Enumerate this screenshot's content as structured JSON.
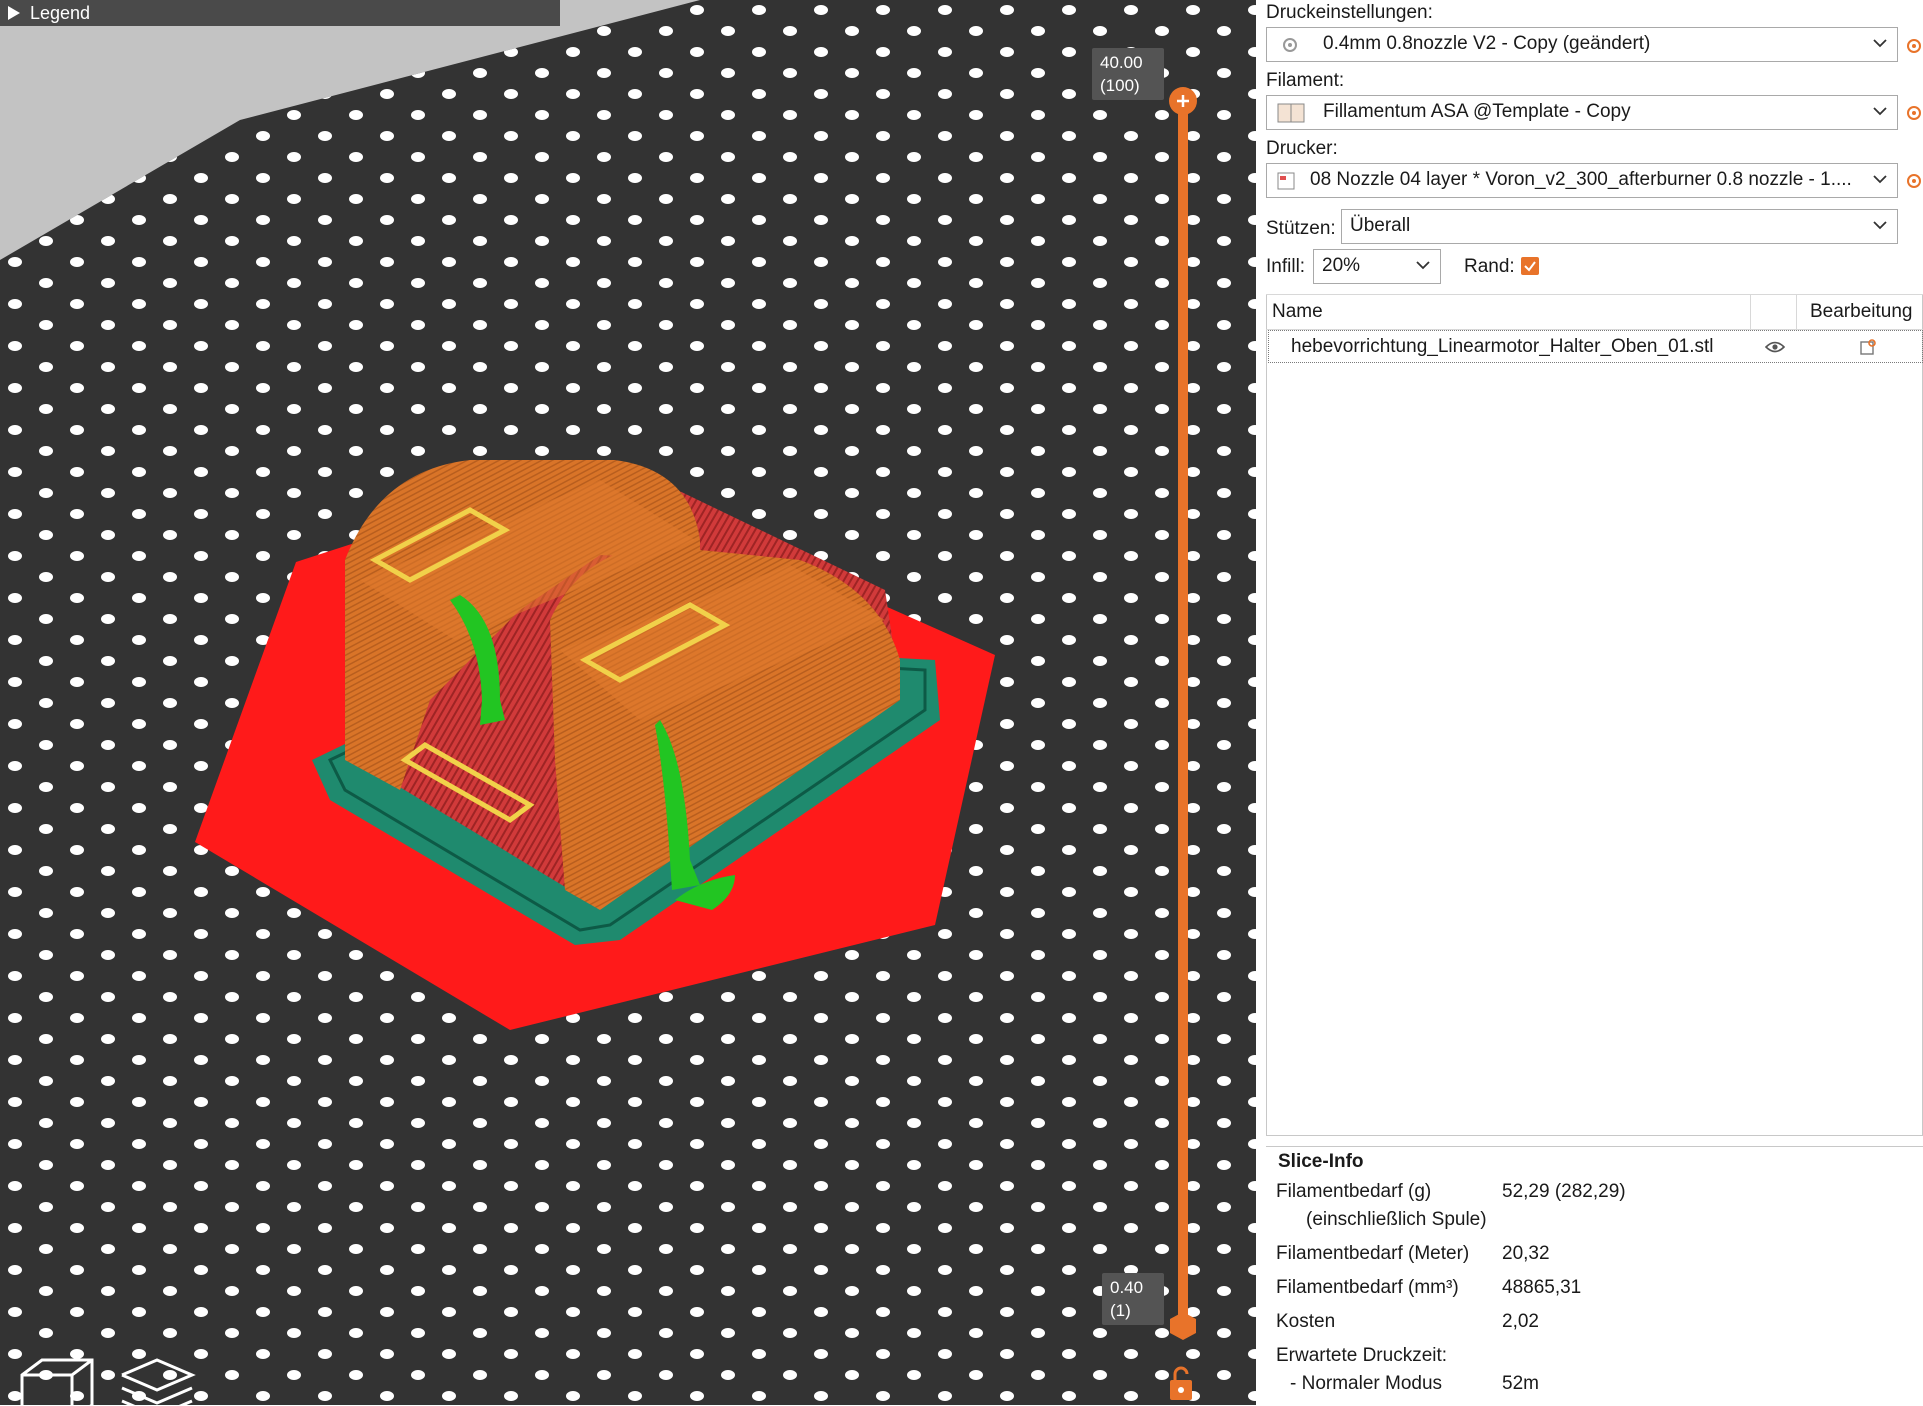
{
  "viewport": {
    "legend_label": "Legend",
    "slider": {
      "top_value": "40.00",
      "top_layer": "(100)",
      "bottom_value": "0.40",
      "bottom_layer": "(1)"
    },
    "accent_color": "#e8732a"
  },
  "print_settings": {
    "label": "Druckeinstellungen:",
    "value": "0.4mm 0.8nozzle V2 - Copy (geändert)"
  },
  "filament": {
    "label": "Filament:",
    "value": "Fillamentum ASA @Template - Copy"
  },
  "printer": {
    "label": "Drucker:",
    "value": "08 Nozzle 04 layer * Voron_v2_300_afterburner 0.8 nozzle - 1...."
  },
  "supports": {
    "label": "Stützen:",
    "value": "Überall"
  },
  "infill": {
    "label": "Infill:",
    "value": "20%"
  },
  "brim": {
    "label": "Rand:",
    "checked": true
  },
  "object_list": {
    "columns": [
      "Name",
      "Bearbeitung"
    ],
    "rows": [
      {
        "name": "hebevorrichtung_Linearmotor_Halter_Oben_01.stl"
      }
    ]
  },
  "slice_info": {
    "title": "Slice-Info",
    "filament_weight_label": "Filamentbedarf (g)",
    "filament_weight_sub": "(einschließlich Spule)",
    "filament_weight_value": "52,29 (282,29)",
    "filament_m_label": "Filamentbedarf (Meter)",
    "filament_m_value": "20,32",
    "filament_mm3_label": "Filamentbedarf (mm³)",
    "filament_mm3_value": "48865,31",
    "cost_label": "Kosten",
    "cost_value": "2,02",
    "time_label": "Erwartete Druckzeit:",
    "mode_label": "- Normaler Modus",
    "mode_value": "52m"
  }
}
